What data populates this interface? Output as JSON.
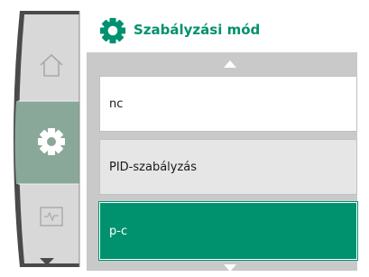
{
  "header": {
    "title": "Szabályzási mód",
    "icon": "gear-icon"
  },
  "nav": {
    "items": [
      {
        "icon": "home-icon",
        "active": false
      },
      {
        "icon": "gear-icon",
        "active": true
      },
      {
        "icon": "waveform-monitor-icon",
        "active": false
      }
    ],
    "scroll_down_icon": "arrow-down-icon"
  },
  "menu": {
    "items": [
      {
        "label": "nc",
        "selected": false
      },
      {
        "label": "PID-szabályzás",
        "selected": false
      },
      {
        "label": "p-c",
        "selected": true
      }
    ],
    "scroll_up_icon": "arrow-up-icon",
    "scroll_down_icon": "arrow-down-icon"
  },
  "colors": {
    "accent": "#00916e",
    "panel": "#c9c9c9",
    "rail": "#d6d6d6",
    "rail_active": "#8aa89a"
  }
}
